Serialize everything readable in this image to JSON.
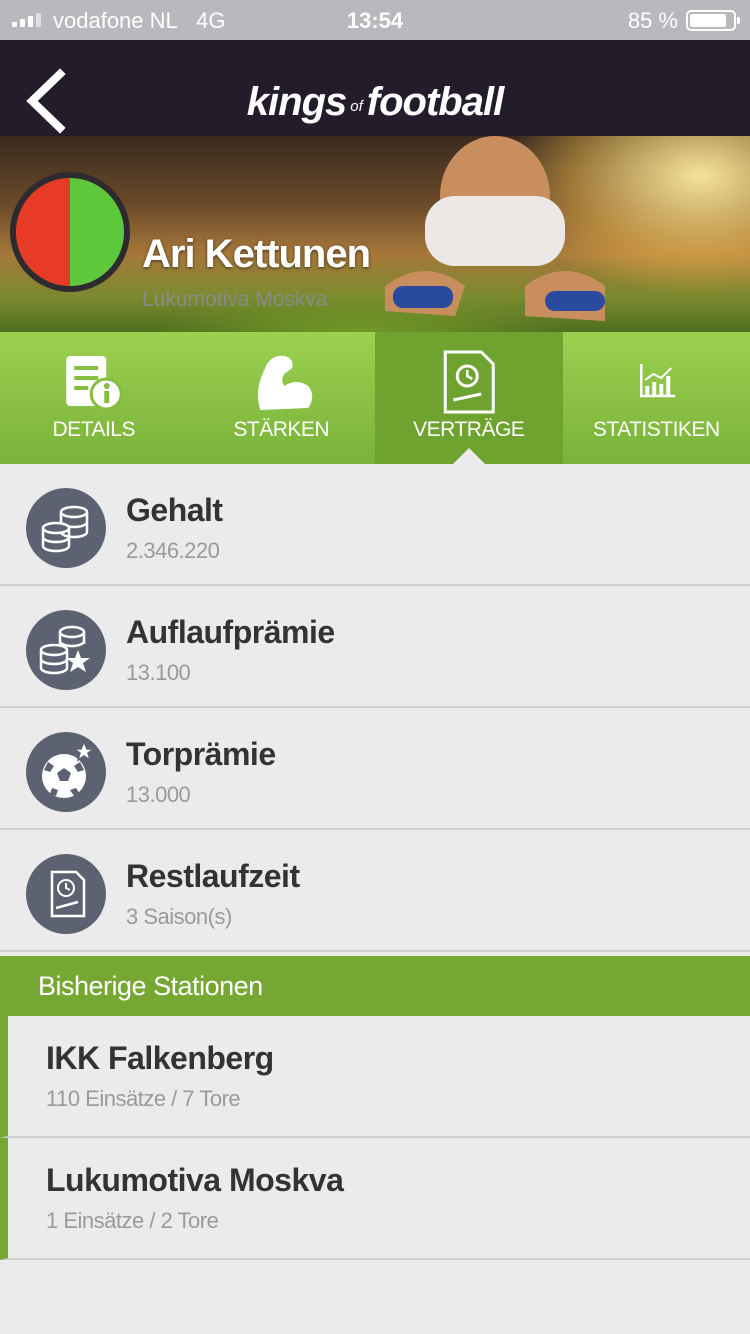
{
  "status_bar": {
    "carrier": "vodafone NL",
    "network": "4G",
    "time": "13:54",
    "battery": "85 %"
  },
  "nav": {
    "logo_kings": "kings",
    "logo_of": "of",
    "logo_football": "football"
  },
  "player": {
    "name": "Ari Kettunen",
    "club": "Lukumotiva Moskva",
    "avatar_colors": [
      "#e73b28",
      "#5ec83d"
    ]
  },
  "tabs": [
    {
      "label": "DETAILS",
      "icon": "document-info-icon",
      "active": false
    },
    {
      "label": "STÄRKEN",
      "icon": "flexed-arm-icon",
      "active": false
    },
    {
      "label": "VERTRÄGE",
      "icon": "contract-icon",
      "active": true
    },
    {
      "label": "STATISTIKEN",
      "icon": "bar-chart-icon",
      "active": false
    }
  ],
  "contract": [
    {
      "title": "Gehalt",
      "value": "2.346.220",
      "icon": "coins-icon"
    },
    {
      "title": "Auflaufprämie",
      "value": "13.100",
      "icon": "coins-star-icon"
    },
    {
      "title": "Torprämie",
      "value": "13.000",
      "icon": "ball-star-icon"
    },
    {
      "title": "Restlaufzeit",
      "value": "3 Saison(s)",
      "icon": "contract-clock-icon"
    }
  ],
  "stations": {
    "header": "Bisherige Stationen",
    "items": [
      {
        "club": "IKK Falkenberg",
        "stats": "110 Einsätze / 7 Tore"
      },
      {
        "club": "Lukumotiva Moskva",
        "stats": "1 Einsätze / 2 Tore"
      }
    ]
  },
  "colors": {
    "nav_bg": "#221c2b",
    "accent_green": "#77a733",
    "tab_active": "#6ea32f",
    "icon_circle": "#5c6272"
  }
}
